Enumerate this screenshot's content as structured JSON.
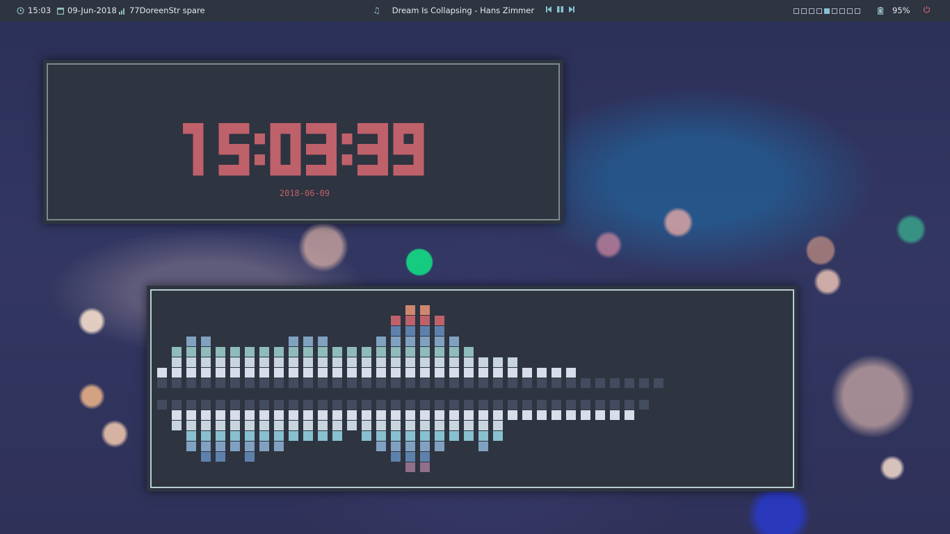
{
  "topbar": {
    "time": "15:03",
    "date": "09-Jun-2018",
    "network": "77DoreenStr spare",
    "now_playing": "Dream Is Collapsing - Hans Zimmer",
    "battery": "95%",
    "workspaces": {
      "count": 9,
      "active_index": 4
    },
    "icons": {
      "time": "clock-icon",
      "date": "calendar-icon",
      "network": "signal-icon",
      "music": "music-note-icon",
      "prev": "skip-previous-icon",
      "play_pause": "pause-icon",
      "next": "skip-next-icon",
      "battery": "battery-icon",
      "power": "power-icon"
    }
  },
  "clock": {
    "time": "15:03:39",
    "date": "2018-06-09",
    "color": "#bf616a"
  },
  "visualizer": {
    "upper_levels": [
      1,
      3,
      4,
      4,
      3,
      3,
      3,
      3,
      3,
      4,
      4,
      4,
      3,
      3,
      3,
      4,
      6,
      7,
      7,
      6,
      4,
      3,
      2,
      2,
      2,
      1,
      1,
      1,
      1,
      0,
      0,
      0,
      0,
      0,
      0
    ],
    "lower_levels": [
      0,
      2,
      4,
      5,
      5,
      4,
      5,
      4,
      4,
      3,
      3,
      3,
      3,
      2,
      3,
      4,
      5,
      6,
      6,
      4,
      3,
      3,
      4,
      3,
      1,
      1,
      1,
      1,
      1,
      1,
      1,
      1,
      1,
      0,
      0
    ],
    "colors": {
      "idle": "#434c5e",
      "level1": "#d8dee9",
      "level2": "#c8d4de",
      "level3": "#8fbcbb",
      "level4": "#81a1c1",
      "level5": "#5e81ac",
      "level6": "#bf616a",
      "level7": "#d08770"
    },
    "lower_colors": {
      "level1": "#d8dee9",
      "level2": "#c8d4de",
      "level3": "#88c0d0",
      "level4": "#81a1c1",
      "level5": "#5e81ac",
      "level6": "#8f6f8a"
    }
  }
}
